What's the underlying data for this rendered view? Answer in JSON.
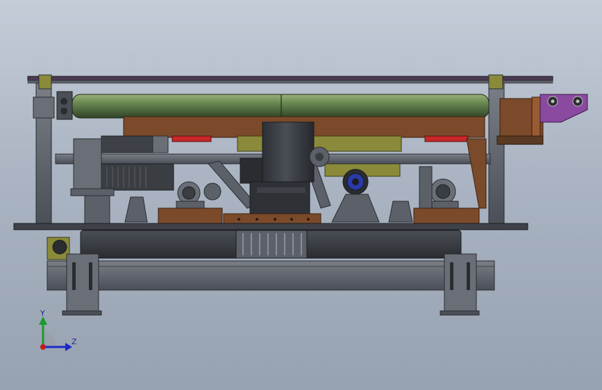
{
  "viewport": {
    "background_top": "#c4ccd8",
    "background_bottom": "#97a2b1"
  },
  "triad": {
    "y_label": "Y",
    "z_label": "Z",
    "y_axis_color": "#1a9a2a",
    "z_axis_color": "#1a2ac8",
    "x_axis_color": "#c81a1a"
  },
  "colors": {
    "frame_gray": "#5c6068",
    "frame_dark": "#3e4248",
    "cylinder_green": "#6b8a52",
    "carriage_brown": "#7a4a2a",
    "gear_body": "#3a3d42",
    "accent_purple": "#8a4aa0",
    "accent_red": "#c82828",
    "accent_blue": "#2a3aa8",
    "mount_yellow": "#8a8a3a"
  }
}
